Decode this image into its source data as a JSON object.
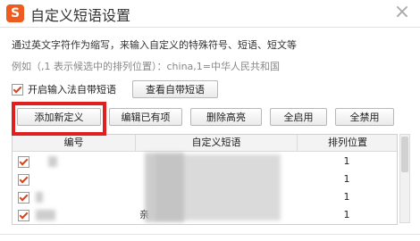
{
  "window": {
    "title": "自定义短语设置",
    "logo_letter": "S"
  },
  "description": {
    "line1": "通过英文字符作为缩写，来输入自定义的特殊符号、短语、短文等",
    "line2": "例如（,1 表示候选中的排列位置）：china,1=中华人民共和国"
  },
  "options": {
    "enable_builtin_label": "开启输入法自带短语",
    "enable_builtin_checked": true,
    "view_builtin_label": "查看自带短语"
  },
  "toolbar": {
    "add_label": "添加新定义",
    "edit_label": "编辑已有项",
    "delete_label": "删除高亮",
    "enable_all_label": "全启用",
    "disable_all_label": "全禁用"
  },
  "table": {
    "columns": [
      "编号",
      "自定义短语",
      "排列位置"
    ],
    "rows": [
      {
        "checked": true,
        "abbr": "",
        "phrase": "",
        "position": "1"
      },
      {
        "checked": true,
        "abbr": "",
        "phrase": "",
        "position": "1"
      },
      {
        "checked": true,
        "abbr": "",
        "phrase": "",
        "position": "1"
      },
      {
        "checked": true,
        "abbr": "",
        "phrase": "亲",
        "position": "1"
      }
    ]
  },
  "colors": {
    "highlight": "#e0201f",
    "logo": "#ef5b1e"
  }
}
